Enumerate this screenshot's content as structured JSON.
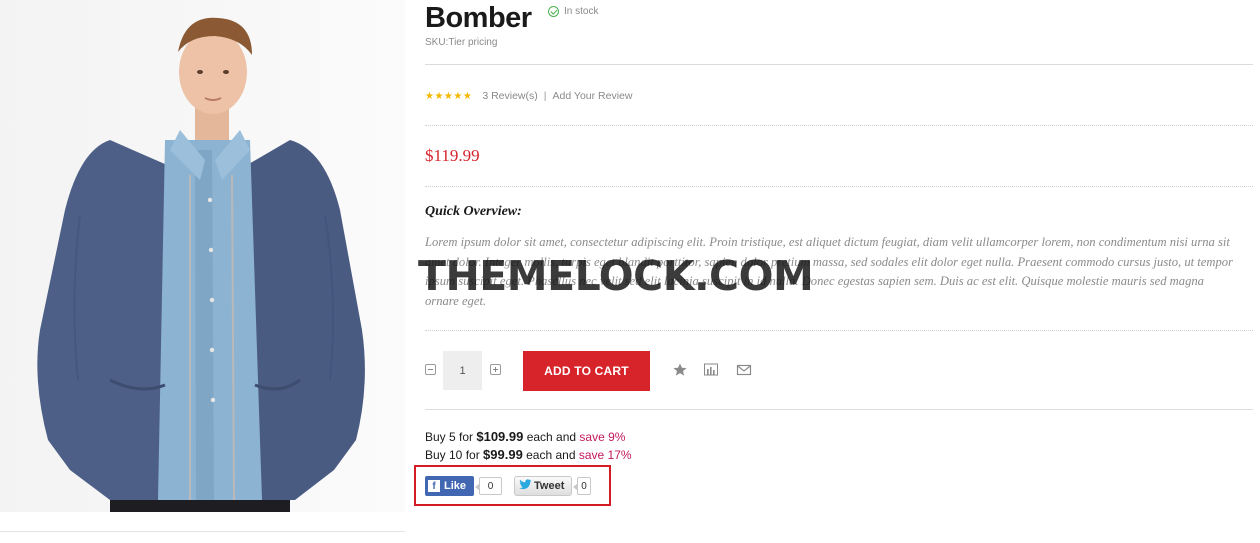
{
  "product": {
    "title": "Bomber",
    "stock_status": "In stock",
    "sku": "SKU:Tier pricing",
    "stars": "★★★★★",
    "reviews": "3 Review(s)",
    "review_sep": "|",
    "add_review": "Add Your Review",
    "price": "$119.99",
    "overview_heading": "Quick Overview:",
    "overview_text": "Lorem ipsum dolor sit amet, consectetur adipiscing elit. Proin tristique, est aliquet dictum feugiat, diam velit ullamcorper lorem, non condimentum nisi urna sit amet dolor. Integer mollis, turpis eget blandit porttitor, sapien dolor pretium massa, sed sodales elit dolor eget nulla. Praesent commodo cursus justo, ut tempor ipsum suscipit eget. Phasellus nec velit sed elit lacinia suscipit in id nulla. Donec egestas sapien sem. Duis ac est elit. Quisque molestie mauris sed magna ornare eget."
  },
  "watermark": "THEMELOCK.COM",
  "cart": {
    "quantity": "1",
    "add_to_cart": "ADD TO CART",
    "actions": [
      "wishlist-star",
      "compare-chart",
      "email-envelope"
    ]
  },
  "tier_pricing": [
    {
      "prefix": "Buy 5 for ",
      "price": "$109.99",
      "mid": " each and ",
      "save": "save 9%"
    },
    {
      "prefix": "Buy 10 for ",
      "price": "$99.99",
      "mid": " each and ",
      "save": "save 17%"
    }
  ],
  "social": {
    "like_label": "Like",
    "like_count": "0",
    "tweet_label": "Tweet",
    "tweet_count": "0"
  },
  "colors": {
    "accent_red": "#d7242b",
    "save_pink": "#c2185b",
    "star_yellow": "#f5b800",
    "facebook_blue": "#4267b2"
  }
}
